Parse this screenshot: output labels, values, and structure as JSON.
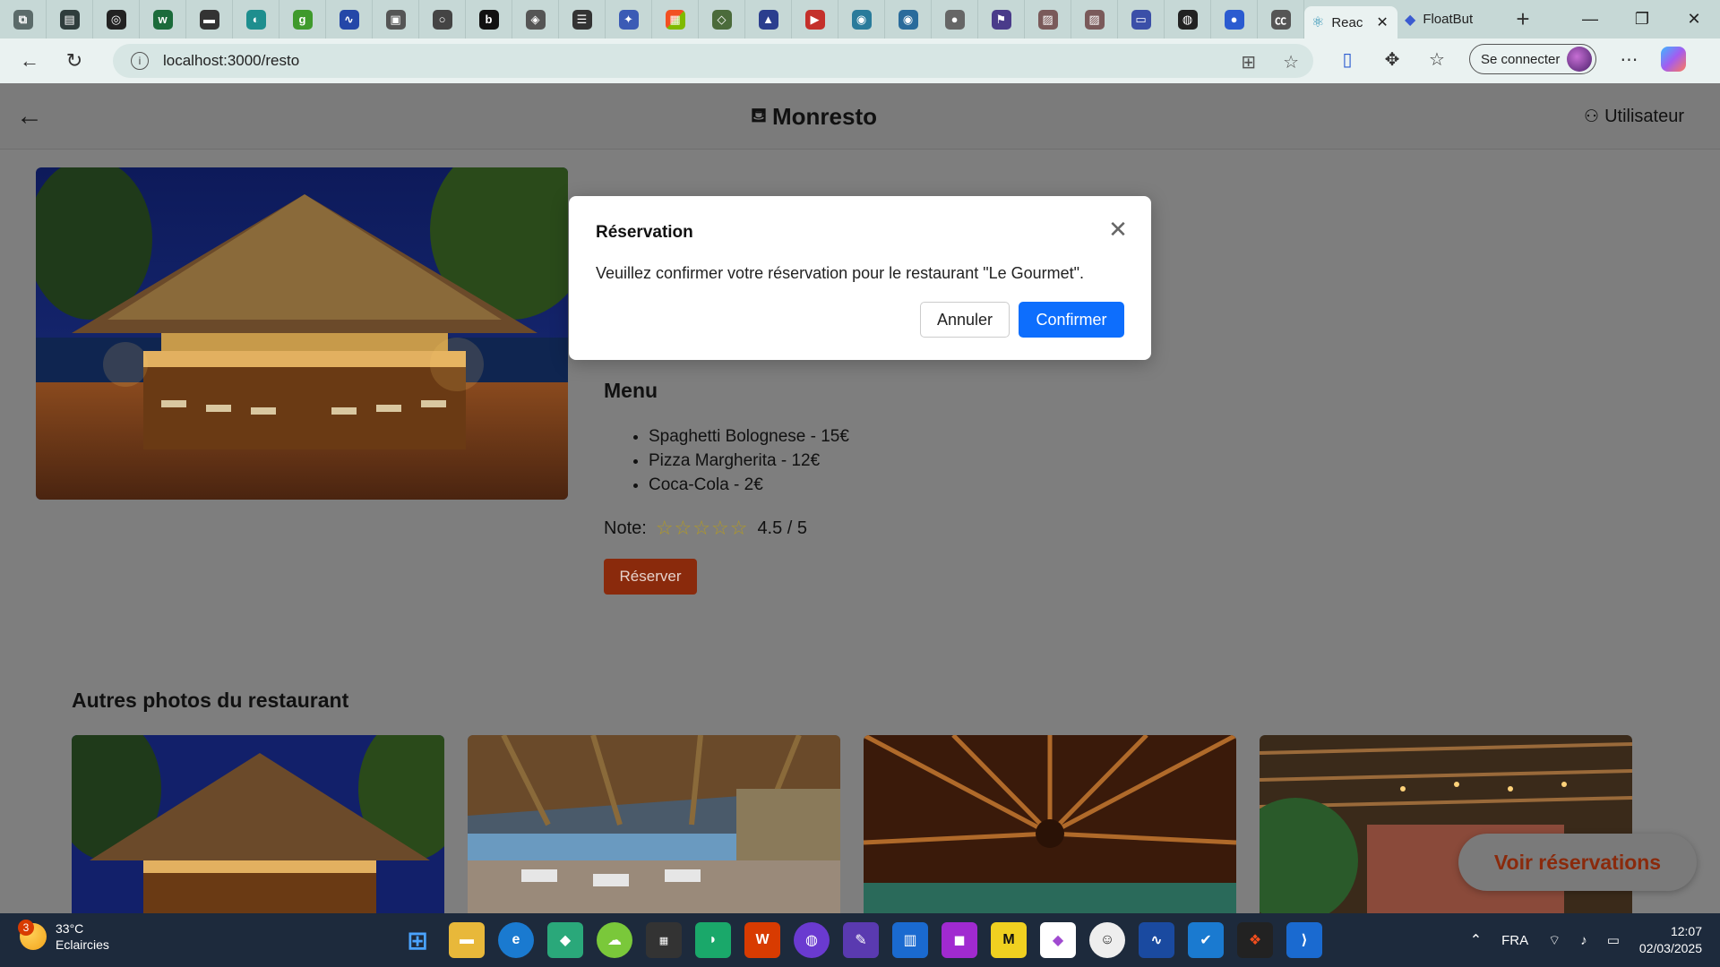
{
  "browser": {
    "tabs": [
      {
        "label": "Reac",
        "icon": "react-icon",
        "active": true
      },
      {
        "label": "FloatBut",
        "icon": "floatbutton-icon",
        "active": false
      }
    ],
    "url": "localhost:3000/resto",
    "signin_label": "Se connecter"
  },
  "header": {
    "brand": "Monresto",
    "user_label": "Utilisateur"
  },
  "restaurant": {
    "menu_title": "Menu",
    "menu_items": [
      "Spaghetti Bolognese - 15€",
      "Pizza Margherita - 12€",
      "Coca-Cola - 2€"
    ],
    "note_label": "Note:",
    "stars": "☆☆☆☆☆",
    "rating": "4.5 / 5",
    "reserve_label": "Réserver"
  },
  "photos": {
    "title": "Autres photos du restaurant"
  },
  "fab": {
    "label": "Voir réservations"
  },
  "modal": {
    "title": "Réservation",
    "body": "Veuillez confirmer votre réservation pour le restaurant \"Le Gourmet\".",
    "cancel_label": "Annuler",
    "confirm_label": "Confirmer"
  },
  "taskbar": {
    "weather_temp": "33°C",
    "weather_desc": "Eclaircies",
    "weather_badge": "3",
    "language": "FRA",
    "time": "12:07",
    "date": "02/03/2025"
  },
  "colors": {
    "overlay_bg": "#7e7e7e",
    "primary": "#0d6efd",
    "reserve": "#8a2a0c"
  }
}
